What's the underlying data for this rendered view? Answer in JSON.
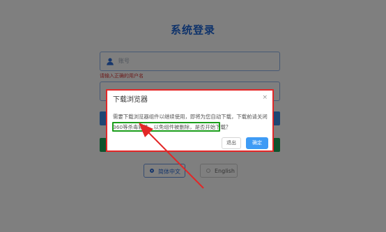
{
  "login": {
    "title": "系统登录",
    "account_placeholder": "账号",
    "error_text": "请输入正确的用户名",
    "languages": [
      "简体中文",
      "English"
    ]
  },
  "dialog": {
    "title": "下载浏览器",
    "close_glyph": "×",
    "message": "需要下载浏览器组件以继续使用，即将为您自动下载，下载前请关闭360等杀毒软件，以免组件被删除，是否开始下载？",
    "exit_label": "退出",
    "ok_label": "确定"
  },
  "colors": {
    "annotation_box": "#e32626",
    "highlight_box": "#1a9d1a",
    "accent": "#3e9bf5"
  }
}
